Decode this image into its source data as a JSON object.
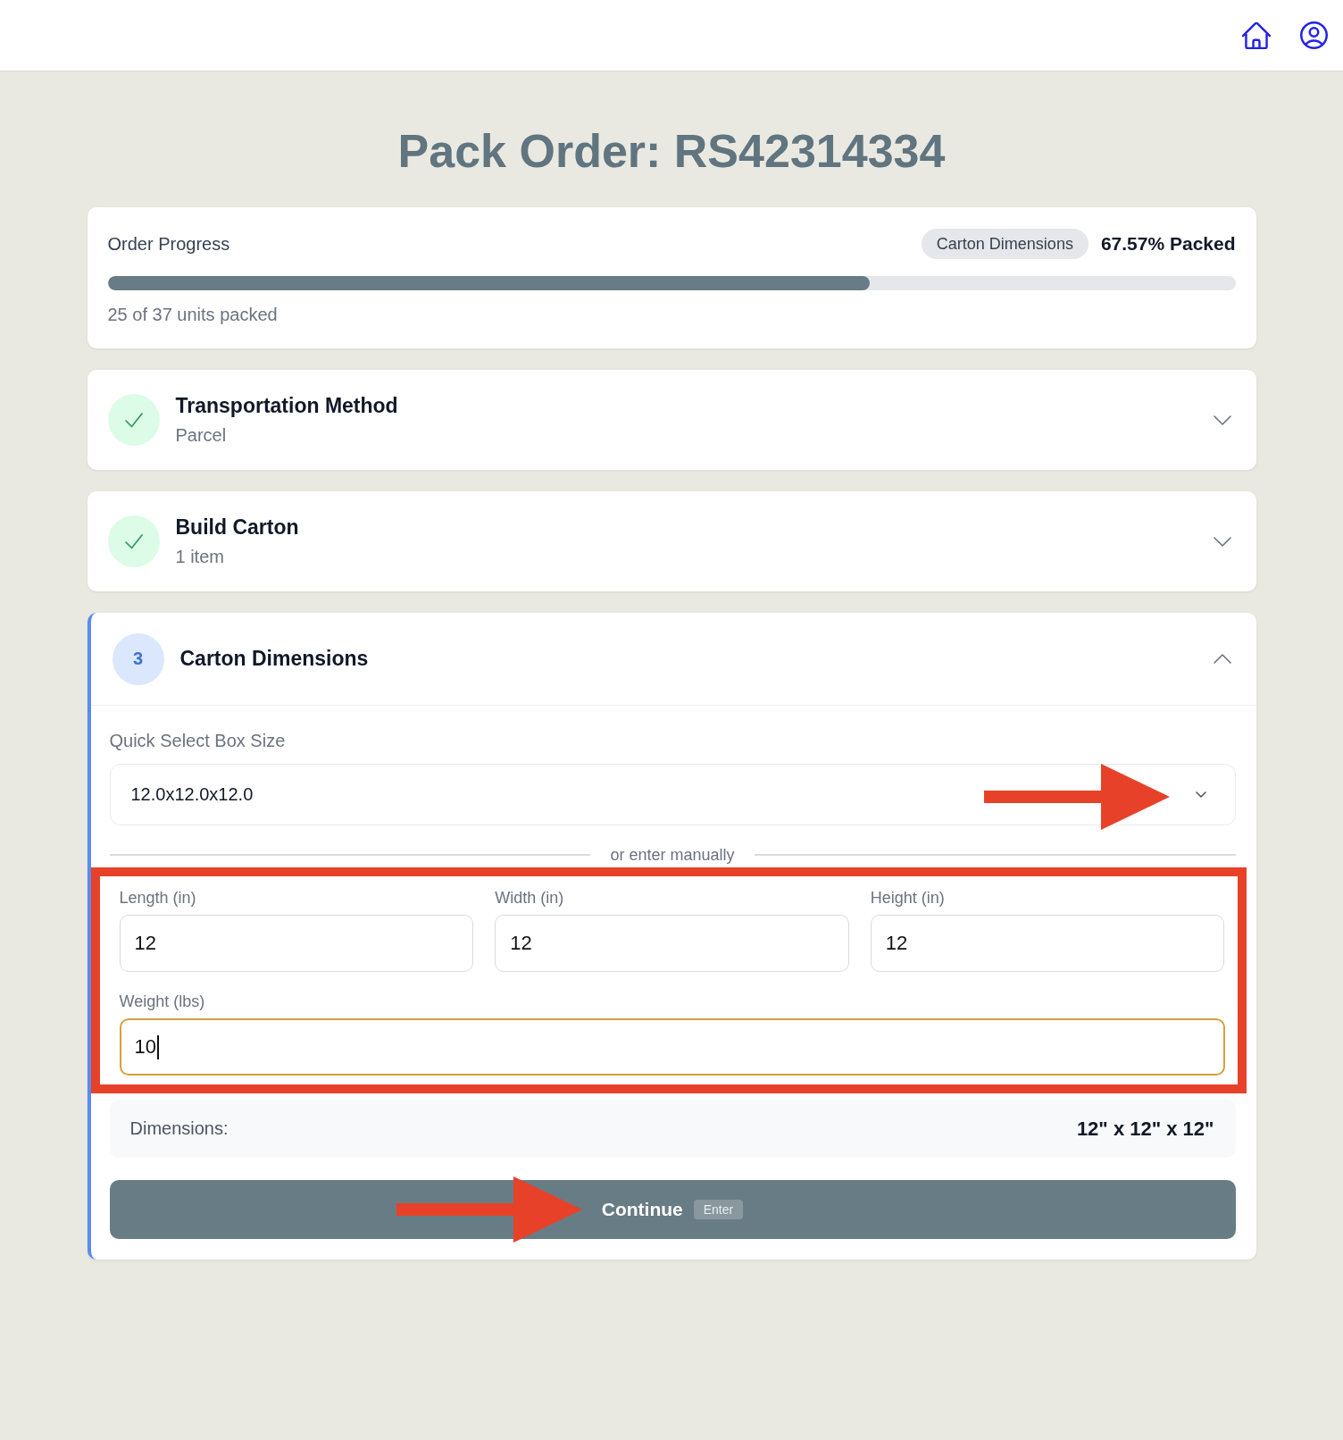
{
  "title": "Pack Order: RS42314334",
  "progress": {
    "title": "Order Progress",
    "badge": "Carton Dimensions",
    "percent_label": "67.57% Packed",
    "level": 0.6757,
    "units_label": "25 of 37 units packed"
  },
  "steps": [
    {
      "title": "Transportation Method",
      "subtitle": "Parcel",
      "completed": true,
      "active": false,
      "expanded": false
    },
    {
      "title": "Build Carton",
      "subtitle": "1 item",
      "completed": true,
      "active": false,
      "expanded": false
    },
    {
      "title": "Carton Dimensions",
      "number": "3",
      "completed": false,
      "active": true,
      "expanded": true,
      "body": {
        "quick_select": {
          "label": "Quick Select Box Size",
          "value": "12.0x12.0x12.0",
          "annotation_arrow": true
        },
        "divider_label": "or enter manually",
        "fields_highlighted": true,
        "field_rows": [
          [
            {
              "label": "Length (in)",
              "value": "12",
              "focused": false
            },
            {
              "label": "Width (in)",
              "value": "12",
              "focused": false
            },
            {
              "label": "Height (in)",
              "value": "12",
              "focused": false
            }
          ],
          [
            {
              "label": "Weight (lbs)",
              "value": "10",
              "focused": true
            }
          ]
        ],
        "summary": {
          "label": "Dimensions:",
          "value": "12\" x 12\" x 12\""
        },
        "continue_button": {
          "label": "Continue",
          "shortcut": "Enter",
          "annotation_arrow": true
        }
      }
    }
  ]
}
